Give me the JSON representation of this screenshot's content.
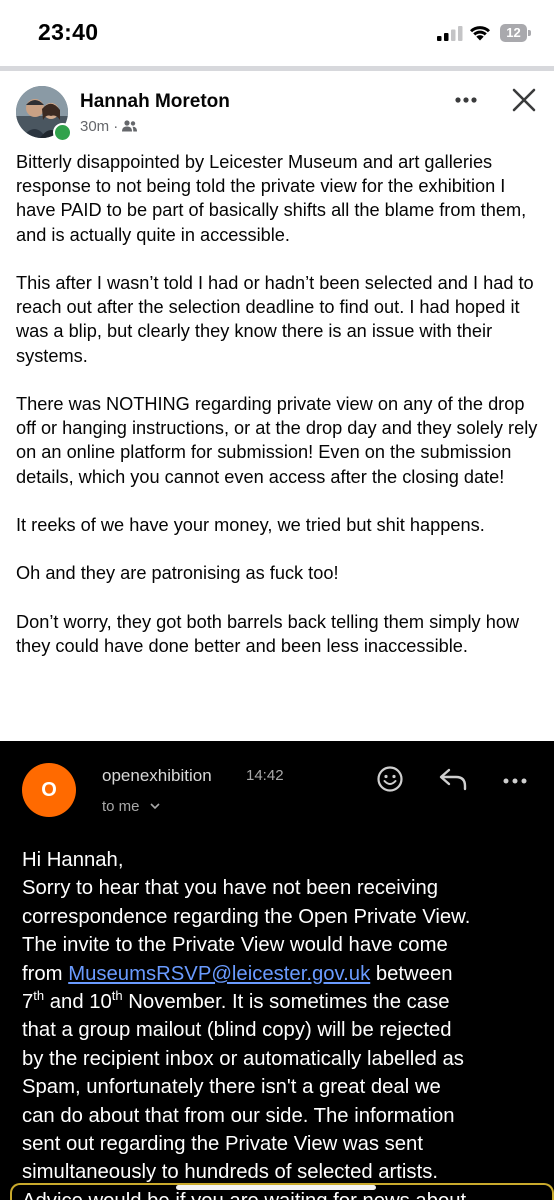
{
  "status_bar": {
    "time": "23:40",
    "battery_level": "12"
  },
  "post": {
    "author": "Hannah Moreton",
    "time_ago": "30m",
    "separator": "·",
    "audience_icon": "friends-icon",
    "paragraphs": [
      "Bitterly disappointed by Leicester Museum and art galleries response to not being told the private view for the exhibition I have PAID to be part of basically shifts all the blame from them, and is actually quite in accessible.",
      "This after I wasn’t told I had or hadn’t been selected and I had to reach out after the selection deadline to find out. I had hoped it was a blip, but clearly they know there is an issue with their systems.",
      "There was NOTHING regarding private view on any of the drop off or hanging instructions, or at the drop day and they solely rely on an online platform for submission! Even on the submission details, which you cannot even access after the closing date!",
      "It reeks of we have your money, we tried but shit happens.",
      "Oh and they are patronising as fuck too!",
      "Don’t worry, they got both barrels back telling them simply how they could have done better and been less inaccessible."
    ]
  },
  "email": {
    "avatar_letter": "O",
    "sender": "openexhibition",
    "time": "14:42",
    "to": "to me",
    "lines": {
      "l1": "Hi Hannah,",
      "l2": "Sorry to hear that you have not been receiving",
      "l3": "correspondence regarding the Open Private View.",
      "l4": "The invite to the Private View would have come",
      "l5_pre": "from ",
      "l5_link": "MuseumsRSVP@leicester.gov.uk",
      "l5_post": " between",
      "l6_a": "7",
      "l6_sup1": "th",
      "l6_b": " and 10",
      "l6_sup2": "th",
      "l6_c": " November. It is sometimes the case",
      "l7": "that a group mailout (blind copy) will be rejected",
      "l8": "by the recipient inbox or automatically labelled as",
      "l9": "Spam, unfortunately there isn't a great deal we",
      "l10": "can do about that from our side. The information",
      "l11": "sent out regarding the Private View was sent",
      "l12": "simultaneously to hundreds of selected artists.",
      "l13": "Advice would be if you are waiting for news about"
    }
  },
  "colors": {
    "accent_orange": "#ff6a00",
    "online_green": "#31a24c",
    "link_blue": "#6a9bff",
    "highlight_yellow": "#c9a92c"
  }
}
